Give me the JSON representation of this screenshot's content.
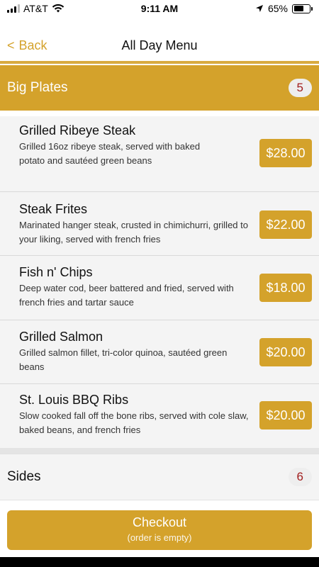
{
  "status_bar": {
    "carrier": "AT&T",
    "time": "9:11 AM",
    "battery_percent": "65%",
    "battery_level": 0.65,
    "icons": [
      "signal-icon",
      "wifi-icon",
      "location-arrow-icon",
      "battery-icon"
    ]
  },
  "nav": {
    "back_label": "Back",
    "title": "All Day Menu"
  },
  "sections": [
    {
      "title": "Big Plates",
      "count": "5",
      "items": [
        {
          "name": "Grilled Ribeye Steak",
          "description": "Grilled 16oz ribeye steak, served with baked potato and sautéed green beans",
          "price": "$28.00"
        },
        {
          "name": "Steak Frites",
          "description": "Marinated hanger steak, crusted in chimichurri, grilled to your liking, served with french fries",
          "price": "$22.00"
        },
        {
          "name": "Fish n' Chips",
          "description": "Deep water cod, beer battered and fried, served with french fries and tartar sauce",
          "price": "$18.00"
        },
        {
          "name": "Grilled Salmon",
          "description": "Grilled salmon fillet, tri-color quinoa, sautéed green beans",
          "price": "$20.00"
        },
        {
          "name": "St. Louis BBQ Ribs",
          "description": "Slow cooked fall off the bone ribs, served with cole slaw, baked beans, and french fries",
          "price": "$20.00"
        }
      ]
    },
    {
      "title": "Sides",
      "count": "6",
      "items": []
    }
  ],
  "checkout": {
    "label": "Checkout",
    "sublabel": "(order is empty)"
  },
  "colors": {
    "accent": "#d4a22b",
    "badge_text": "#a11d1d"
  }
}
